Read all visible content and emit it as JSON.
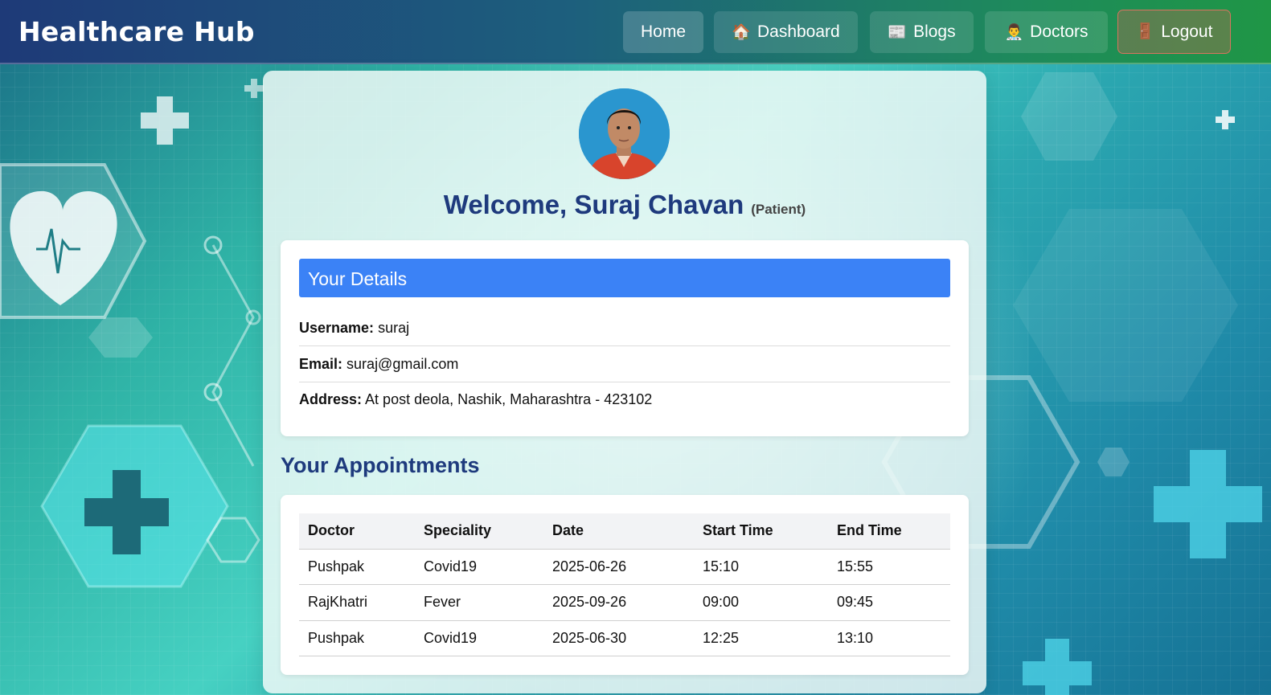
{
  "navbar": {
    "brand": "Healthcare Hub",
    "items": [
      {
        "label": "Home",
        "icon": ""
      },
      {
        "label": "Dashboard",
        "icon": "house-icon"
      },
      {
        "label": "Blogs",
        "icon": "newspaper-icon"
      },
      {
        "label": "Doctors",
        "icon": "doctor-icon"
      },
      {
        "label": "Logout",
        "icon": "door-icon"
      }
    ]
  },
  "profile": {
    "welcome": "Welcome, Suraj Chavan",
    "role": "(Patient)"
  },
  "details": {
    "header": "Your Details",
    "username_label": "Username:",
    "username": "suraj",
    "email_label": "Email:",
    "email": "suraj@gmail.com",
    "address_label": "Address:",
    "address": "At post deola, Nashik, Maharashtra - 423102"
  },
  "appointments": {
    "title": "Your Appointments",
    "columns": [
      "Doctor",
      "Speciality",
      "Date",
      "Start Time",
      "End Time"
    ],
    "rows": [
      [
        "Pushpak",
        "Covid19",
        "2025-06-26",
        "15:10",
        "15:55"
      ],
      [
        "RajKhatri",
        "Fever",
        "2025-09-26",
        "09:00",
        "09:45"
      ],
      [
        "Pushpak",
        "Covid19",
        "2025-06-30",
        "12:25",
        "13:10"
      ]
    ]
  },
  "colors": {
    "accent": "#3b82f6",
    "heading": "#1e3a7d",
    "logout_border": "#d9735f"
  }
}
